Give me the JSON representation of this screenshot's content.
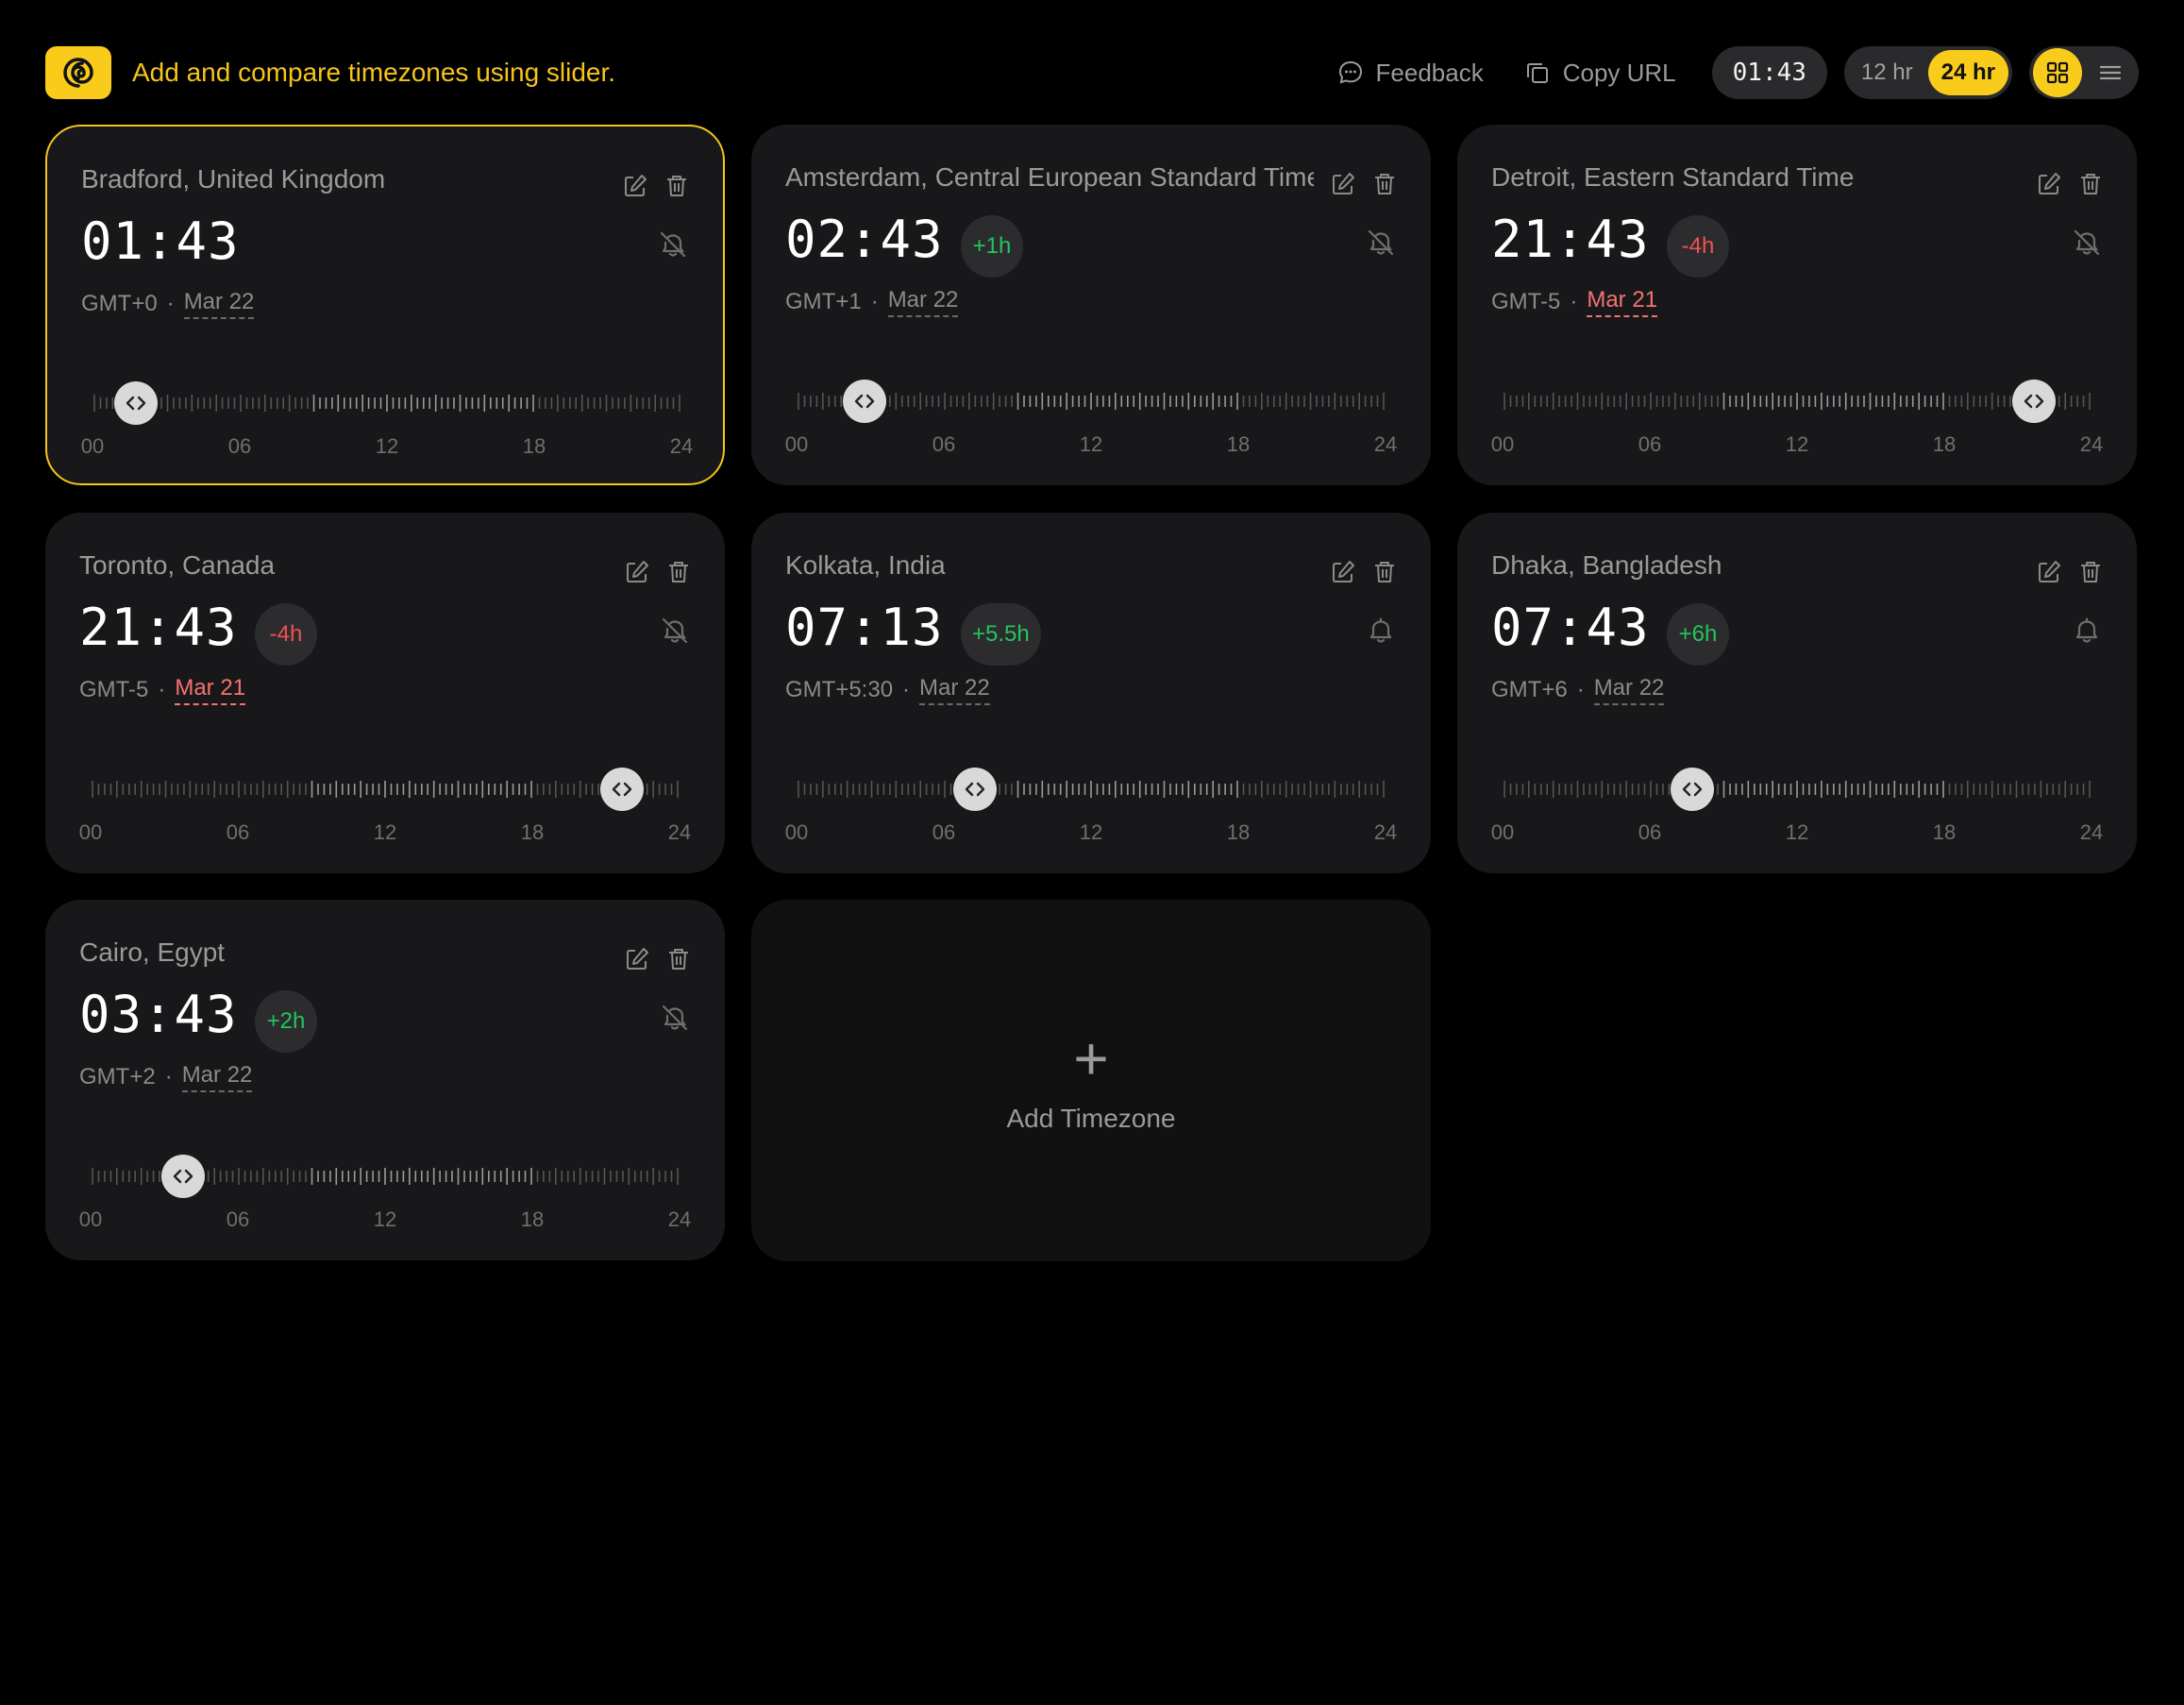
{
  "header": {
    "tagline": "Add and compare timezones using slider.",
    "feedback_label": "Feedback",
    "copy_url_label": "Copy URL",
    "current_time": "01:43",
    "format_options": [
      "12 hr",
      "24 hr"
    ],
    "format_selected": "24 hr",
    "view_selected": "grid",
    "icons": {
      "logo": "spiral-logo-icon",
      "feedback": "chat-bubble-icon",
      "copy": "copy-icon",
      "grid": "grid-icon",
      "list": "menu-icon"
    }
  },
  "colors": {
    "accent": "#f9cc1c",
    "positive": "#22c55e",
    "negative": "#f05252",
    "card_bg": "#18181a",
    "page_bg": "#000000"
  },
  "slider_labels": [
    "00",
    "06",
    "12",
    "18",
    "24"
  ],
  "timezones": [
    {
      "name": "Bradford, United Kingdom",
      "time": "01:43",
      "diff": "",
      "gmt": "GMT+0",
      "date": "Mar 22",
      "date_prev_day": false,
      "alarm_on": false,
      "selected": true,
      "slider_hour": 1.72
    },
    {
      "name": "Amsterdam, Central European Standard Time",
      "time": "02:43",
      "diff": "+1h",
      "gmt": "GMT+1",
      "date": "Mar 22",
      "date_prev_day": false,
      "alarm_on": false,
      "selected": false,
      "slider_hour": 2.72
    },
    {
      "name": "Detroit, Eastern Standard Time",
      "time": "21:43",
      "diff": "-4h",
      "gmt": "GMT-5",
      "date": "Mar 21",
      "date_prev_day": true,
      "alarm_on": false,
      "selected": false,
      "slider_hour": 21.72
    },
    {
      "name": "Toronto, Canada",
      "time": "21:43",
      "diff": "-4h",
      "gmt": "GMT-5",
      "date": "Mar 21",
      "date_prev_day": true,
      "alarm_on": false,
      "selected": false,
      "slider_hour": 21.72
    },
    {
      "name": "Kolkata, India",
      "time": "07:13",
      "diff": "+5.5h",
      "gmt": "GMT+5:30",
      "date": "Mar 22",
      "date_prev_day": false,
      "alarm_on": true,
      "selected": false,
      "slider_hour": 7.22
    },
    {
      "name": "Dhaka, Bangladesh",
      "time": "07:43",
      "diff": "+6h",
      "gmt": "GMT+6",
      "date": "Mar 22",
      "date_prev_day": false,
      "alarm_on": true,
      "selected": false,
      "slider_hour": 7.72
    },
    {
      "name": "Cairo, Egypt",
      "time": "03:43",
      "diff": "+2h",
      "gmt": "GMT+2",
      "date": "Mar 22",
      "date_prev_day": false,
      "alarm_on": false,
      "selected": false,
      "slider_hour": 3.72
    }
  ],
  "add_card": {
    "label": "Add Timezone",
    "icon": "plus-icon"
  }
}
